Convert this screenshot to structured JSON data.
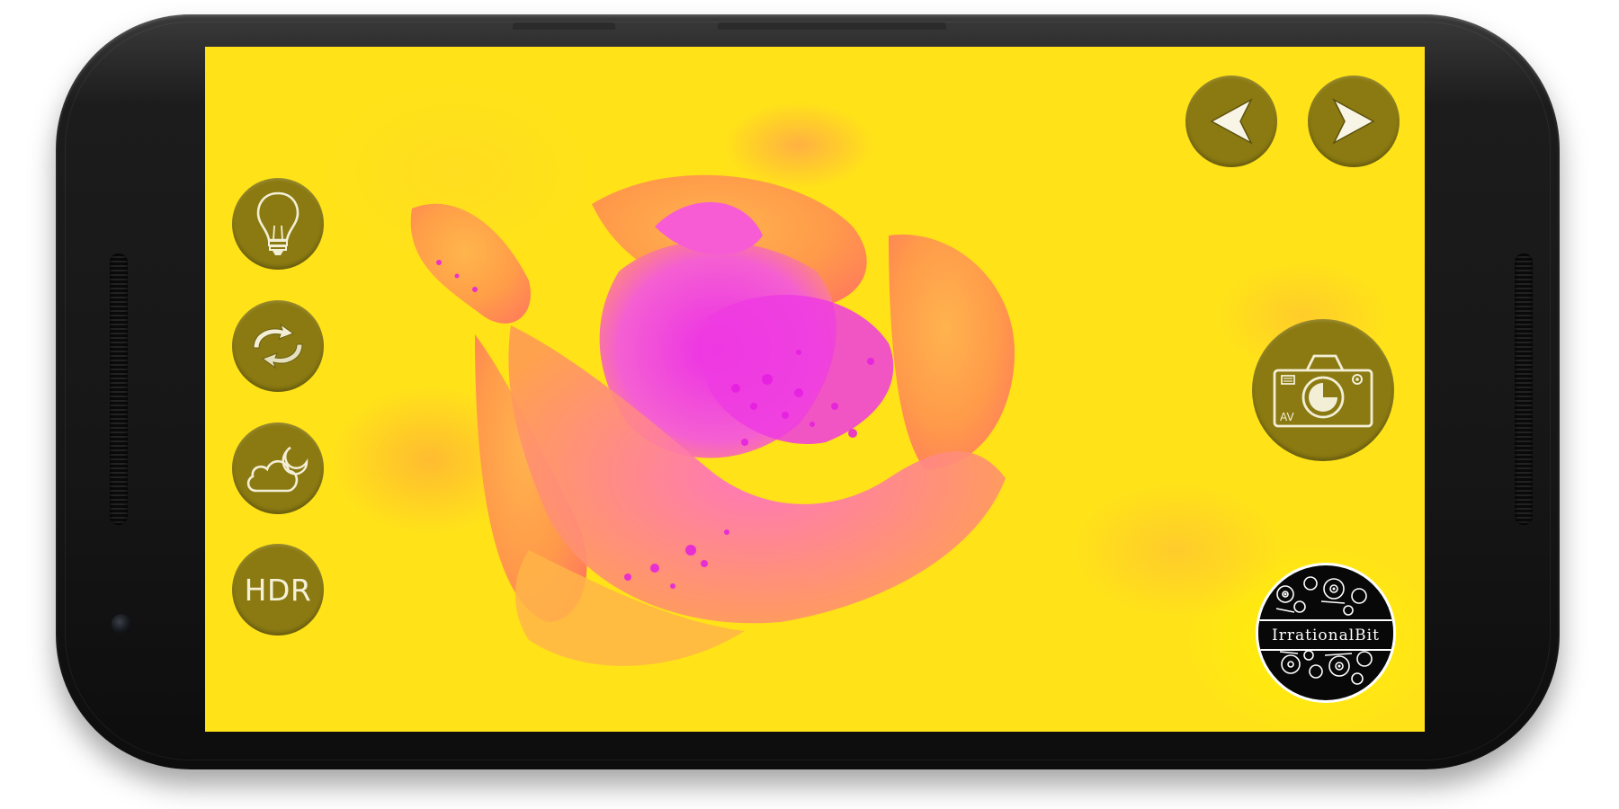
{
  "camera_controls": {
    "flash_icon": "lightbulb-icon",
    "switch_camera_icon": "rotate-arrows-icon",
    "night_mode_icon": "cloud-moon-icon",
    "hdr_label": "HDR"
  },
  "navigation": {
    "previous_icon": "chevron-left-icon",
    "next_icon": "chevron-right-icon"
  },
  "capture": {
    "shutter_icon": "camera-icon",
    "mode_label": "AV"
  },
  "branding": {
    "logo_text": "IrrationalBit"
  },
  "colors": {
    "button_fill": "#8b7a12",
    "icon_stroke": "#f3efd6",
    "viewfinder_base": "#ffe318",
    "rose_magenta": "#f23ce8",
    "rose_orange": "#ff9a4a"
  }
}
